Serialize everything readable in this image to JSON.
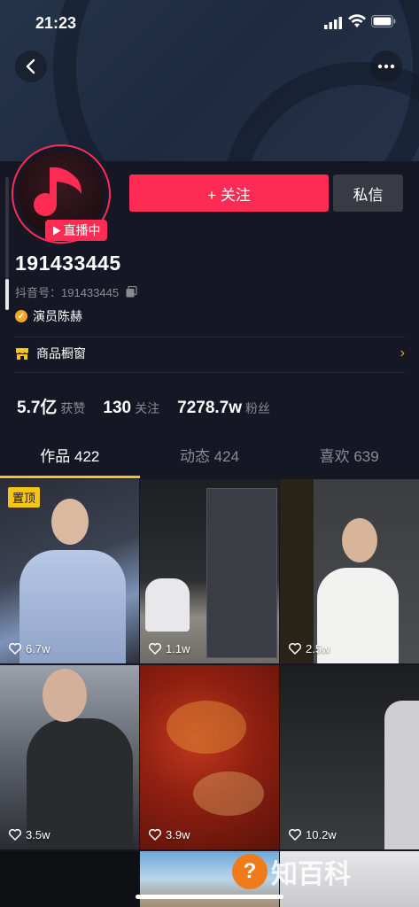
{
  "status_bar": {
    "time": "21:23"
  },
  "profile": {
    "live_badge": "直播中",
    "follow_label": "+ 关注",
    "message_label": "私信",
    "nickname": "191433445",
    "douyin_id": "抖音号：191433445",
    "verified_label": "演员陈赫",
    "verified_mark": "✓",
    "shop_label": "商品橱窗",
    "shop_chevron": "›"
  },
  "stats": [
    {
      "value": "5.7亿",
      "label": "获赞"
    },
    {
      "value": "130",
      "label": "关注"
    },
    {
      "value": "7278.7w",
      "label": "粉丝"
    }
  ],
  "tabs": [
    {
      "label": "作品 422",
      "active": true
    },
    {
      "label": "动态 424",
      "active": false
    },
    {
      "label": "喜欢 639",
      "active": false
    }
  ],
  "videos": [
    {
      "likes": "6.7w",
      "pinned": "置顶"
    },
    {
      "likes": "1.1w"
    },
    {
      "likes": "2.5w"
    },
    {
      "likes": "3.5w"
    },
    {
      "likes": "3.9w"
    },
    {
      "likes": "10.2w"
    }
  ],
  "watermark": {
    "mark": "?",
    "text": "知百科"
  },
  "colors": {
    "accent": "#fe2c55",
    "tab_indicator": "#f5c518",
    "verified": "#f5a623",
    "background": "#161724"
  },
  "icons": [
    "back-icon",
    "more-icon",
    "music-note-icon",
    "play-icon",
    "copy-icon",
    "shop-icon",
    "heart-icon"
  ]
}
